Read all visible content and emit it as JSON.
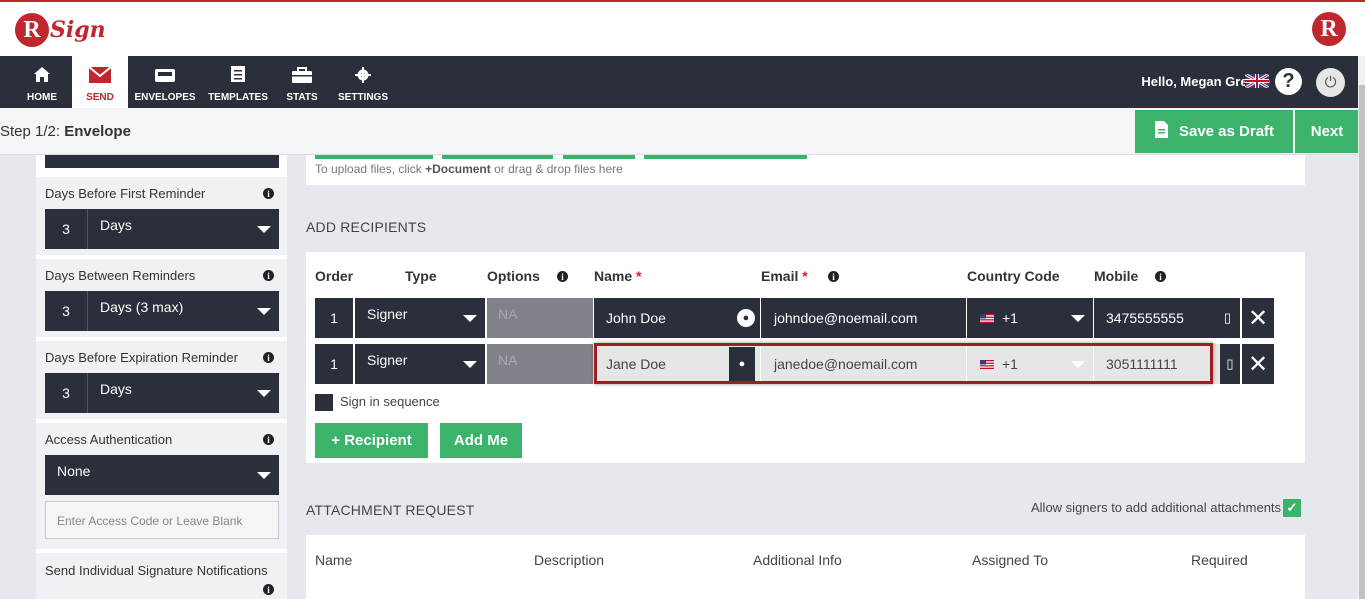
{
  "brand": {
    "logo_letter": "R",
    "logo_text": "Sign"
  },
  "nav": {
    "items": [
      {
        "label": "HOME",
        "icon": "home-icon"
      },
      {
        "label": "SEND",
        "icon": "envelope-icon",
        "active": true
      },
      {
        "label": "ENVELOPES",
        "icon": "inbox-icon"
      },
      {
        "label": "TEMPLATES",
        "icon": "templates-icon"
      },
      {
        "label": "STATS",
        "icon": "briefcase-icon"
      },
      {
        "label": "SETTINGS",
        "icon": "gear-icon"
      }
    ],
    "greeting": "Hello, Megan Greene"
  },
  "step": {
    "prefix": "Step 1/2:",
    "name": "Envelope"
  },
  "actions": {
    "save_draft": "Save as Draft",
    "next": "Next"
  },
  "left_panel": {
    "first_reminder": {
      "label": "Days Before First Reminder",
      "value": "3",
      "unit": "Days"
    },
    "between_reminders": {
      "label": "Days Between Reminders",
      "value": "3",
      "unit": "Days (3 max)"
    },
    "expiration_reminder": {
      "label": "Days Before Expiration Reminder",
      "value": "3",
      "unit": "Days"
    },
    "access_auth": {
      "label": "Access Authentication",
      "value": "None",
      "placeholder": "Enter Access Code or Leave Blank"
    },
    "individual_notifications": {
      "label": "Send Individual Signature Notifications"
    }
  },
  "upload": {
    "text_before": "To upload files, click ",
    "link": "+Document",
    "text_after": " or drag & drop files here"
  },
  "recipients": {
    "title": "ADD RECIPIENTS",
    "columns": {
      "order": "Order",
      "type": "Type",
      "options": "Options",
      "name": "Name",
      "email": "Email",
      "country_code": "Country Code",
      "mobile": "Mobile",
      "required_mark": "*"
    },
    "rows": [
      {
        "order": "1",
        "type": "Signer",
        "options": "NA",
        "name": "John Doe",
        "email": "johndoe@noemail.com",
        "country_code": "+1",
        "mobile": "3475555555"
      },
      {
        "order": "1",
        "type": "Signer",
        "options": "NA",
        "name": "Jane Doe",
        "email": "janedoe@noemail.com",
        "country_code": "+1",
        "mobile": "3051111111"
      }
    ],
    "sign_in_sequence": "Sign in sequence",
    "add_recipient": "+ Recipient",
    "add_me": "Add Me"
  },
  "attachments": {
    "title": "ATTACHMENT REQUEST",
    "allow_label": "Allow signers to add additional attachments",
    "allow_checked": true,
    "columns": [
      "Name",
      "Description",
      "Additional Info",
      "Assigned To",
      "Required"
    ]
  },
  "colors": {
    "brand_red": "#c0262d",
    "nav_dark": "#2b2e3b",
    "accent_green": "#3bb36b"
  }
}
